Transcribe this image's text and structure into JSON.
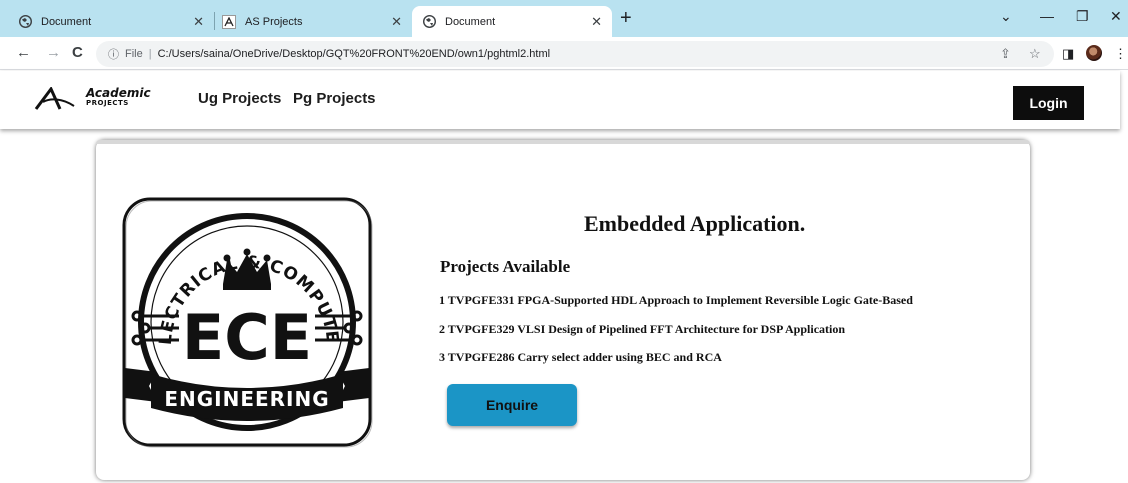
{
  "browser": {
    "tabs": [
      {
        "title": "Document",
        "icon": "globe-icon",
        "active": false
      },
      {
        "title": "AS Projects",
        "icon": "site-favicon",
        "active": false
      },
      {
        "title": "Document",
        "icon": "globe-icon",
        "active": true
      }
    ],
    "new_tab_symbol": "+",
    "address": {
      "scheme_label": "File",
      "url": "C:/Users/saina/OneDrive/Desktop/GQT%20FRONT%20END/own1/pghtml2.html"
    }
  },
  "header": {
    "logo": {
      "line1": "Academic",
      "line2": "PROJECTS"
    },
    "nav": [
      {
        "label": "Ug Projects"
      },
      {
        "label": "Pg Projects"
      }
    ],
    "login_label": "Login"
  },
  "card": {
    "emblem": {
      "arc_text": "ELECTRICAL & COMPUTER",
      "center_text": "ECE",
      "banner_text": "ENGINEERING"
    },
    "title": "Embedded Application.",
    "subtitle": "Projects Available",
    "projects": [
      "1 TVPGFE331 FPGA-Supported HDL Approach to Implement Reversible Logic Gate-Based",
      "2 TVPGFE329 VLSI Design of Pipelined FFT Architecture for DSP Application",
      "3 TVPGFE286 Carry select adder using BEC and RCA"
    ],
    "enquire_label": "Enquire"
  },
  "colors": {
    "tabbar": "#b9e2f0",
    "enquire_button": "#1b95c6",
    "login_button": "#0d0d0d"
  }
}
